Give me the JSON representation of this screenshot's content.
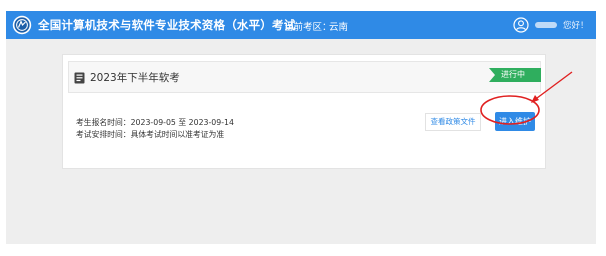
{
  "header": {
    "title": "全国计算机技术与软件专业技术资格（水平）考试",
    "region_label": "当前考区：",
    "region_value": "云南",
    "user_name": "您好！",
    "logo_icon": "exam-logo-icon",
    "user_icon": "user-circle-icon",
    "menu_icon": "caret-down-icon"
  },
  "exam": {
    "title": "2023年下半年软考",
    "status": "进行中",
    "registration_time": "考生报名时间：2023-09-05 至 2023-09-14",
    "schedule_time": "考试安排时间：具体考试时间以准考证为准",
    "view_docs_label": "查看政策文件",
    "enter_label": "进入维护"
  },
  "colors": {
    "primary": "#2f8ae6",
    "status_green": "#2fae5e",
    "annotation_red": "#e02020"
  }
}
